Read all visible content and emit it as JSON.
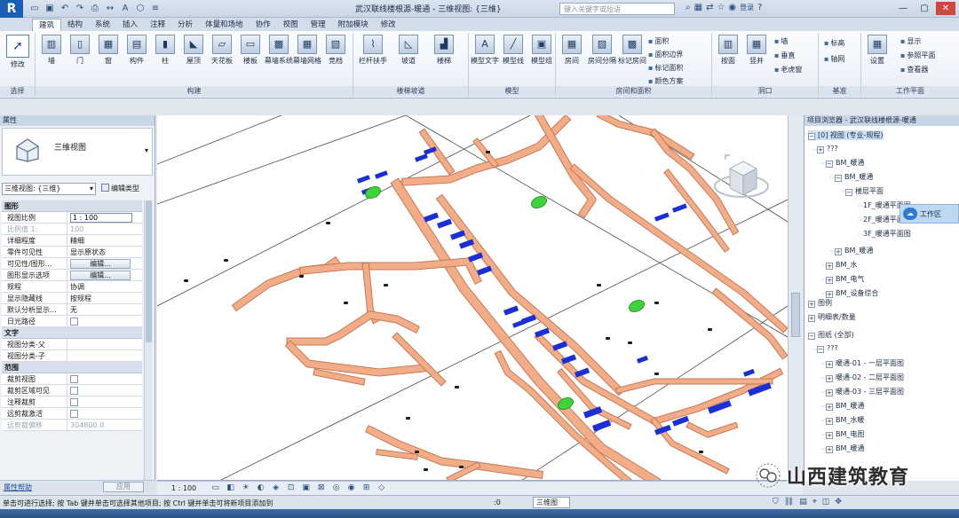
{
  "window": {
    "app_logo": "R",
    "title": "武汉联线楼根源-暖通 - 三维视图: {三维}",
    "search_placeholder": "键入关键字或短语",
    "user_label": "登录"
  },
  "ribbon": {
    "tabs": [
      "建筑",
      "结构",
      "系统",
      "插入",
      "注释",
      "分析",
      "体量和场地",
      "协作",
      "视图",
      "管理",
      "附加模块",
      "修改"
    ],
    "active_tab": "建筑",
    "modify": {
      "label": "修改",
      "group": "选择"
    },
    "build": {
      "group": "构建",
      "buttons": [
        "墙",
        "门",
        "窗",
        "构件",
        "柱",
        "屋顶",
        "天花板",
        "楼板",
        "幕墙系统",
        "幕墙网格",
        "竞档"
      ]
    },
    "circulation": {
      "group": "楼梯坡道",
      "buttons": [
        "栏杆扶手",
        "坡道",
        "楼梯"
      ]
    },
    "model": {
      "group": "模型",
      "buttons": [
        "模型文字",
        "模型线",
        "模型组"
      ]
    },
    "room": {
      "group": "房间和面积",
      "buttons": [
        "房间",
        "房间分隔",
        "标记房间"
      ],
      "small": [
        "面积",
        "面积边界",
        "标记面积",
        "颜色方案"
      ]
    },
    "opening": {
      "group": "洞口",
      "buttons": [
        "按面",
        "竖井"
      ],
      "small": [
        "墙",
        "垂直",
        "老虎窗"
      ]
    },
    "datum": {
      "group": "基准",
      "small": [
        "标高",
        "轴网"
      ]
    },
    "workplane": {
      "group": "工作平面",
      "buttons": [
        "设置"
      ],
      "small": [
        "显示",
        "参照平面",
        "查看器"
      ]
    }
  },
  "properties": {
    "header": "属性",
    "type_name": "三维视图",
    "view_selector": "三维视图: {三维}",
    "edit_type": "编辑类型",
    "sections": [
      {
        "title": "图形",
        "rows": [
          {
            "k": "视图比例",
            "v": "1 : 100",
            "kind": "input"
          },
          {
            "k": "比例值 1:",
            "v": "100",
            "kind": "dim"
          },
          {
            "k": "详细程度",
            "v": "精细",
            "kind": "text"
          },
          {
            "k": "零件可见性",
            "v": "显示原状态",
            "kind": "text"
          },
          {
            "k": "可见性/图形...",
            "v": "编辑...",
            "kind": "button"
          },
          {
            "k": "图形显示选项",
            "v": "编辑...",
            "kind": "button"
          },
          {
            "k": "规程",
            "v": "协调",
            "kind": "text"
          },
          {
            "k": "显示隐藏线",
            "v": "按规程",
            "kind": "text"
          },
          {
            "k": "默认分析显示...",
            "v": "无",
            "kind": "text"
          },
          {
            "k": "日光路径",
            "v": "",
            "kind": "check"
          }
        ]
      },
      {
        "title": "文字",
        "rows": [
          {
            "k": "视图分类-父",
            "v": "",
            "kind": "text"
          },
          {
            "k": "视图分类-子",
            "v": "",
            "kind": "text"
          }
        ]
      },
      {
        "title": "范围",
        "rows": [
          {
            "k": "裁剪视图",
            "v": "",
            "kind": "check"
          },
          {
            "k": "裁剪区域可见",
            "v": "",
            "kind": "check"
          },
          {
            "k": "注释裁剪",
            "v": "",
            "kind": "check"
          },
          {
            "k": "远剪裁激活",
            "v": "",
            "kind": "check"
          },
          {
            "k": "远剪裁偏移",
            "v": "304800.0",
            "kind": "dim"
          }
        ]
      }
    ],
    "help": "属性帮助",
    "apply": "应用"
  },
  "browser": {
    "header": "项目浏览器 - 武汉联线楼根源-暖通",
    "items": [
      {
        "label": "[0] 视图 (专业-规程)",
        "toggle": "−",
        "sel": true
      },
      {
        "label": "???",
        "toggle": "+"
      },
      {
        "label": "BM_暖通",
        "toggle": "−"
      },
      {
        "label": "BM_暖通",
        "toggle": "−"
      },
      {
        "label": "楼层平面",
        "toggle": "−"
      },
      {
        "label": "1F_暖通平面图",
        "toggle": ""
      },
      {
        "label": "2F_暖通平面图",
        "toggle": ""
      },
      {
        "label": "3F_暖通平面图",
        "toggle": ""
      },
      {
        "label": "BM_暖通",
        "toggle": "+"
      },
      {
        "label": "BM_水",
        "toggle": "+"
      },
      {
        "label": "BM_电气",
        "toggle": "+"
      },
      {
        "label": "BM_设备综合",
        "toggle": "+"
      },
      {
        "label": "图例",
        "toggle": "+"
      },
      {
        "label": "明细表/数量",
        "toggle": "+"
      },
      {
        "label": "图纸 (全部)",
        "toggle": "−"
      },
      {
        "label": "???",
        "toggle": "−"
      },
      {
        "label": "暖通-01 - 一层平面图",
        "toggle": "+"
      },
      {
        "label": "暖通-02 - 二层平面图",
        "toggle": "+"
      },
      {
        "label": "暖通-03 - 三层平面图",
        "toggle": "+"
      },
      {
        "label": "BM_暖通",
        "toggle": "+"
      },
      {
        "label": "BM_水暖",
        "toggle": "+"
      },
      {
        "label": "BM_电图",
        "toggle": "+"
      },
      {
        "label": "BM_暖通",
        "toggle": "+"
      }
    ],
    "cloud_chip": "工作区"
  },
  "viewbar": {
    "scale": "1 : 100"
  },
  "status": {
    "text": "单击可进行选择; 按 Tab 键并单击可选择其他项目; 按 Ctrl 键并单击可将新项目添加到",
    "coord": ":0",
    "view": "三维图"
  },
  "watermark": "山西建筑教育",
  "colors": {
    "duct": "#f2ad88",
    "duct_edge": "#c47a55",
    "terminal": "#1a2fd6",
    "equipment": "#3fd23a",
    "accent": "#1a5fb4"
  }
}
